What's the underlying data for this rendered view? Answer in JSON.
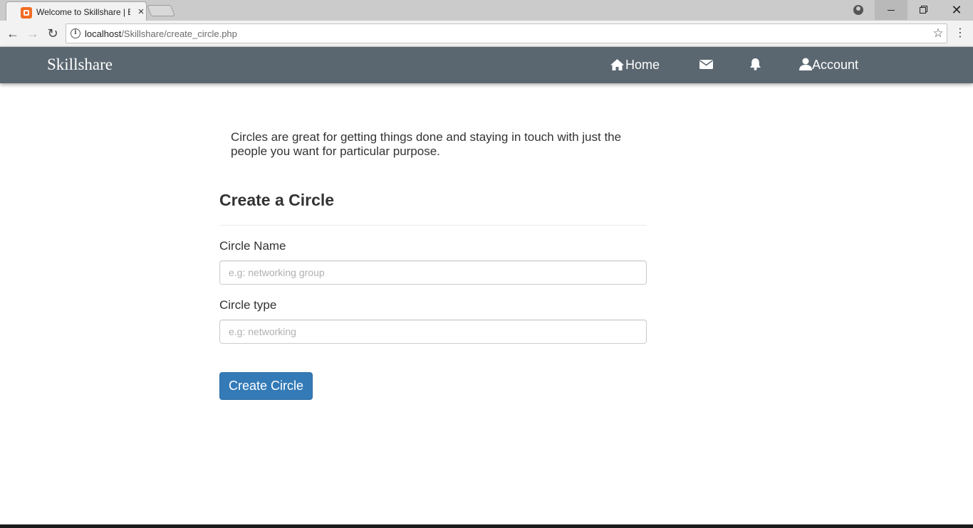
{
  "browser": {
    "tab_title": "Welcome to Skillshare | B",
    "tab_close": "×",
    "url_host": "localhost",
    "url_path": "/Skillshare/create_circle.php",
    "info_glyph": "i",
    "star_glyph": "☆",
    "menu_glyph": "⋮",
    "back_glyph": "←",
    "forward_glyph": "→",
    "reload_glyph": "↻",
    "close_glyph": "✕"
  },
  "navbar": {
    "brand": "Skillshare",
    "home_label": "Home",
    "account_label": "Account",
    "color": "#5a6770"
  },
  "intro": {
    "text": "Circles are great for getting things done and staying in touch with just the people you want for particular purpose."
  },
  "form": {
    "title": "Create a Circle",
    "name_label": "Circle Name",
    "name_placeholder": "e.g: networking group",
    "type_label": "Circle type",
    "type_placeholder": "e.g: networking",
    "submit_label": "Create Circle",
    "submit_color": "#337ab7"
  }
}
